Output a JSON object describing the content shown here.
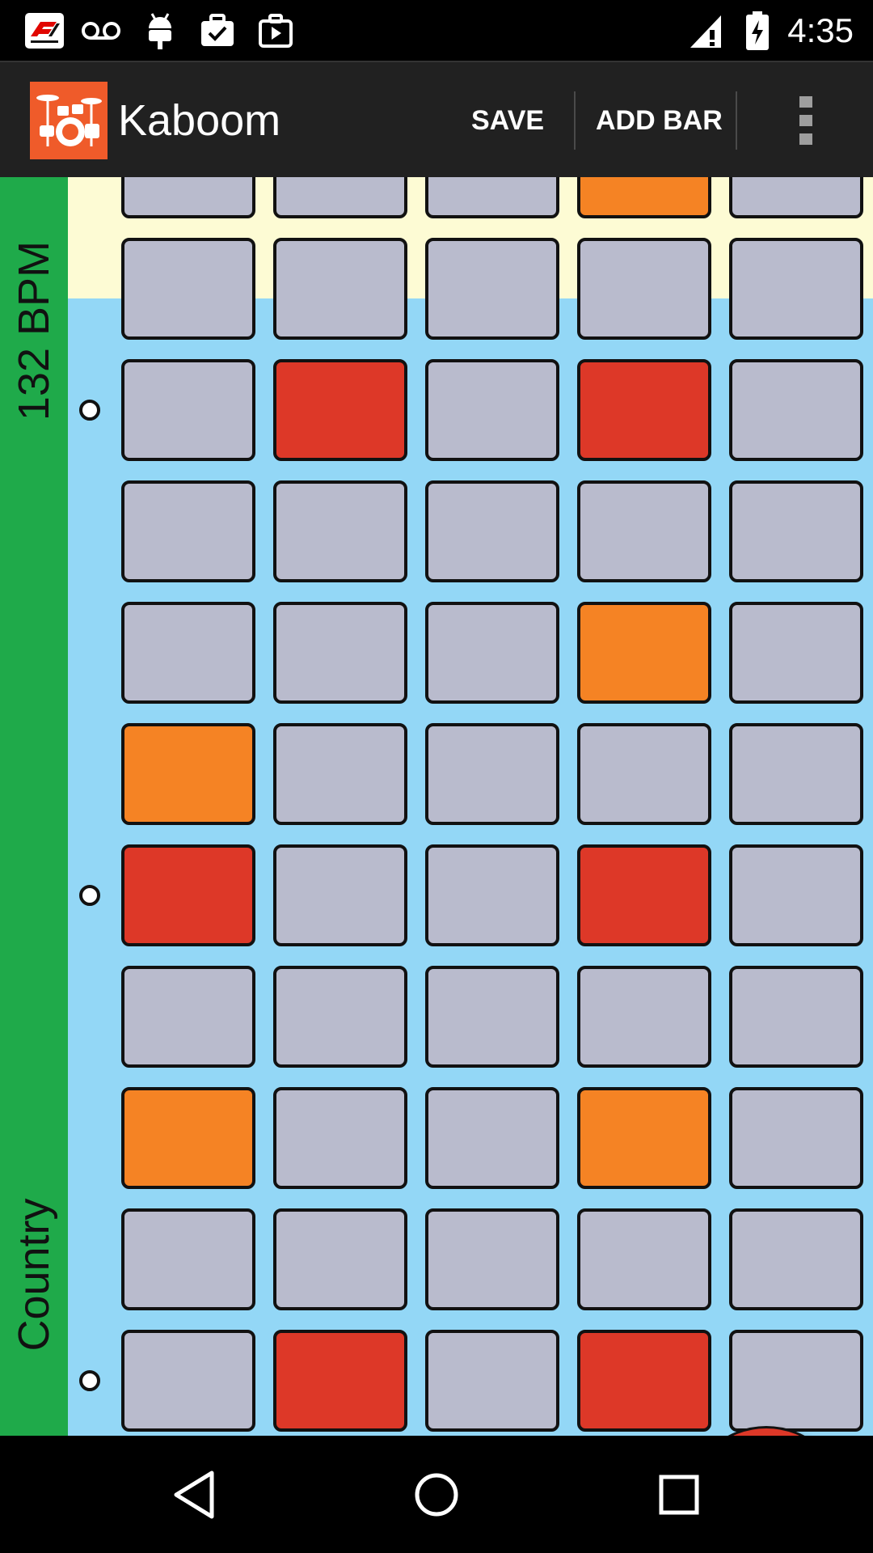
{
  "status_bar": {
    "time": "4:35",
    "icons": [
      "f1-app-icon",
      "voicemail-icon",
      "android-debug-icon",
      "task-briefcase-icon",
      "play-store-icon",
      "signal-icon",
      "battery-charging-icon"
    ]
  },
  "app_bar": {
    "title": "Kaboom",
    "save_label": "SAVE",
    "add_bar_label": "ADD BAR",
    "overflow_icon": "more-vert-icon"
  },
  "sidebar": {
    "bpm": "132 BPM",
    "style": "Country",
    "color": "#1faa4a"
  },
  "grid": {
    "columns": 5,
    "rows": [
      [
        "off",
        "off",
        "off",
        "orange",
        "off"
      ],
      [
        "off",
        "off",
        "off",
        "off",
        "off"
      ],
      [
        "off",
        "red",
        "off",
        "red",
        "off"
      ],
      [
        "off",
        "off",
        "off",
        "off",
        "off"
      ],
      [
        "off",
        "off",
        "off",
        "orange",
        "off"
      ],
      [
        "orange",
        "off",
        "off",
        "off",
        "off"
      ],
      [
        "red",
        "off",
        "off",
        "red",
        "off"
      ],
      [
        "off",
        "off",
        "off",
        "off",
        "off"
      ],
      [
        "orange",
        "off",
        "off",
        "orange",
        "off"
      ],
      [
        "off",
        "off",
        "off",
        "off",
        "off"
      ],
      [
        "off",
        "red",
        "off",
        "red",
        "off"
      ]
    ],
    "beat_marker_rows": [
      2,
      6,
      10
    ],
    "highlighted_rows": [
      0,
      1
    ],
    "colors": {
      "off": "#b9bbcd",
      "orange": "#f58324",
      "red": "#dd3828",
      "background": "#93d7f6",
      "highlight": "#fdfbd4"
    }
  },
  "play_button": {
    "icon": "play-icon",
    "color": "#dd3828"
  },
  "nav_bar": {
    "icons": [
      "back-icon",
      "home-icon",
      "recents-icon"
    ]
  }
}
